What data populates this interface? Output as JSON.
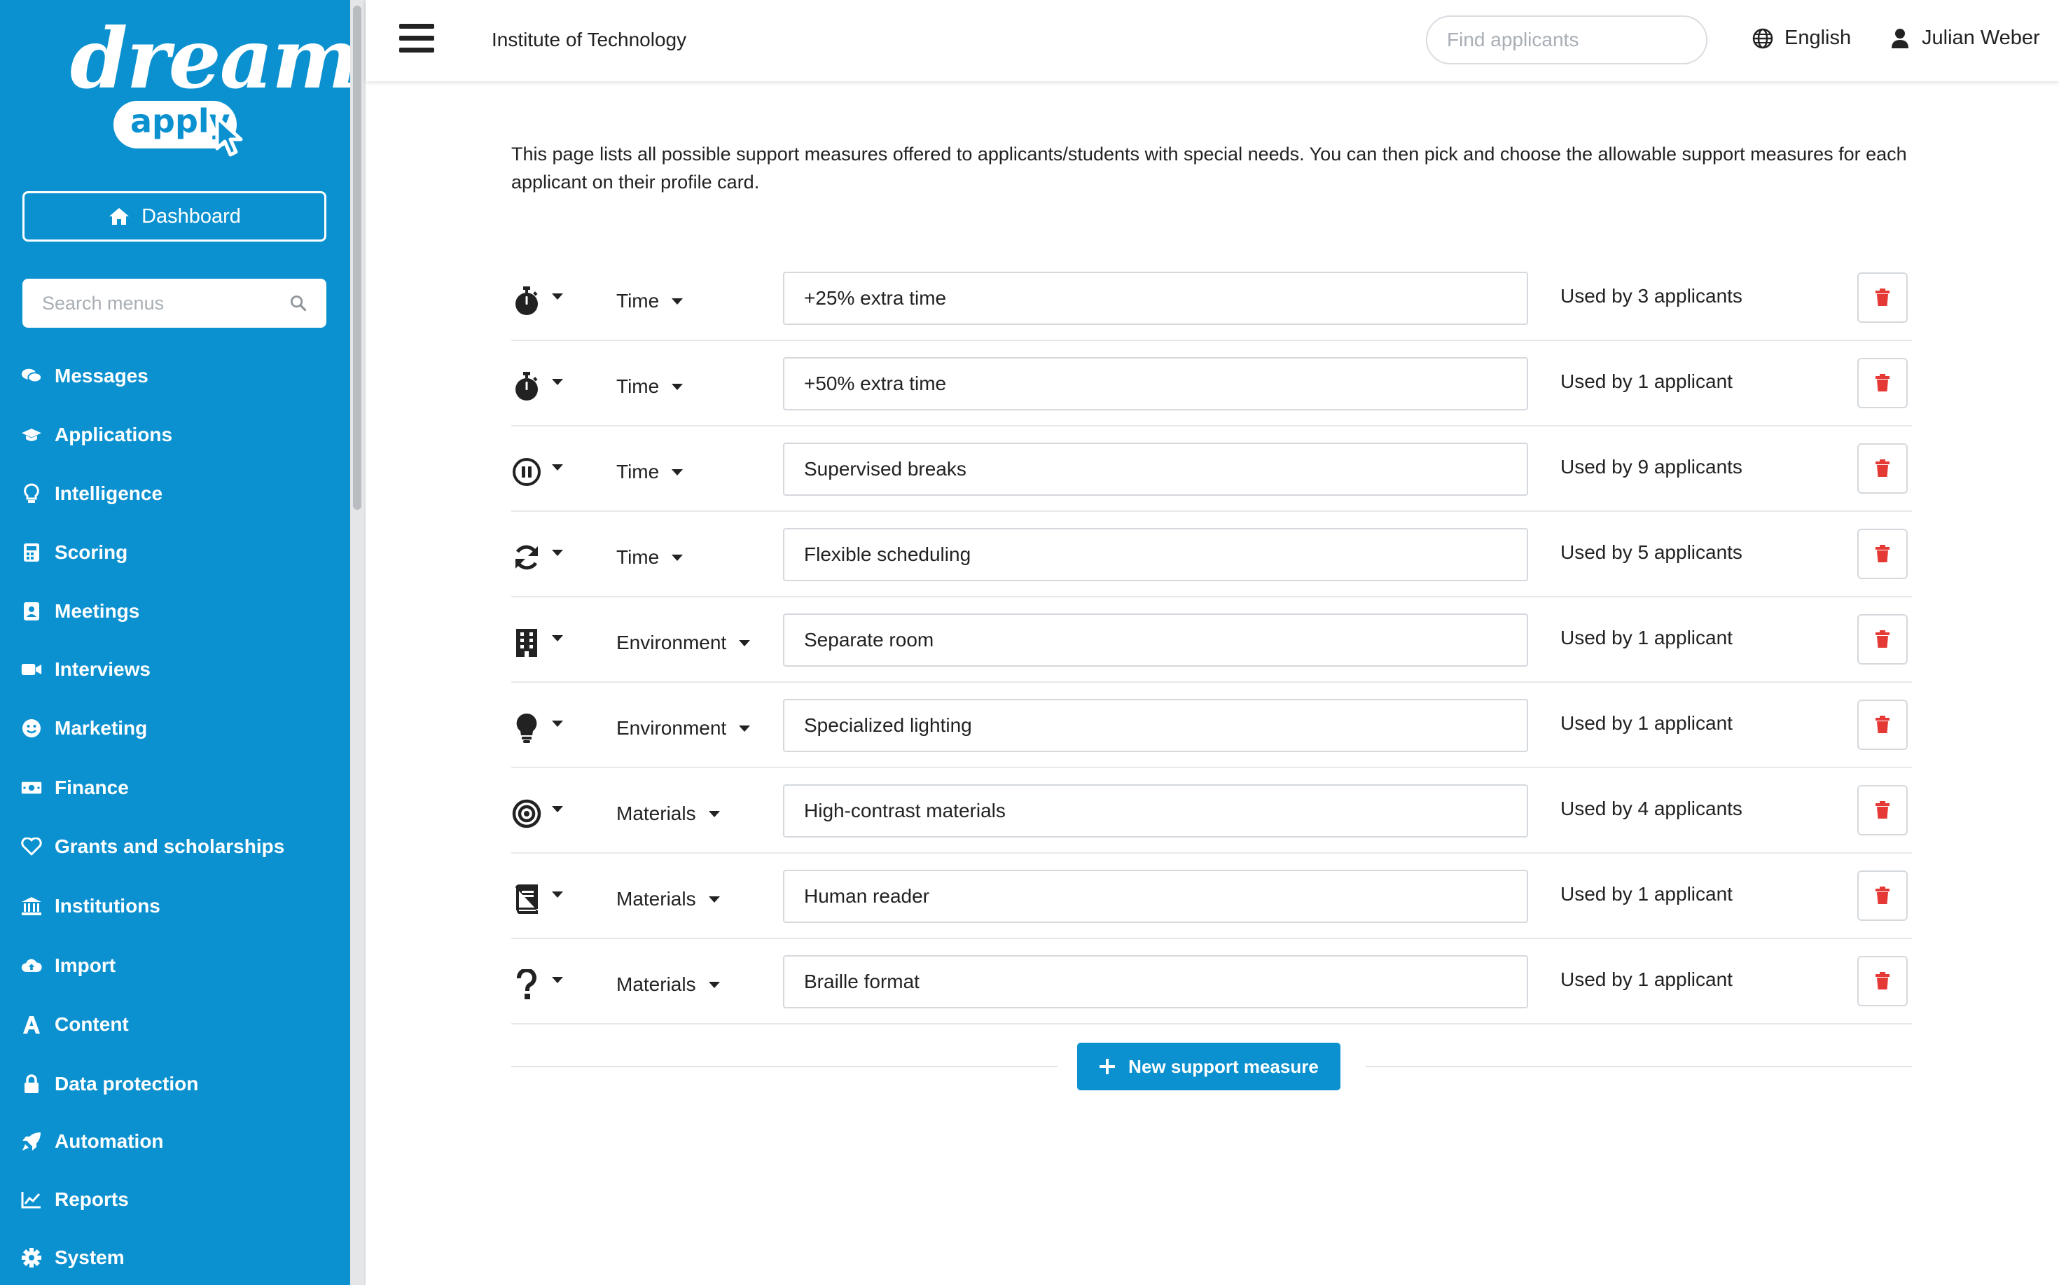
{
  "brand": {
    "word1": "dream",
    "word2": "apply"
  },
  "sidebar": {
    "dashboard_label": "Dashboard",
    "search_placeholder": "Search menus",
    "items": [
      {
        "label": "Messages",
        "icon": "messages-icon"
      },
      {
        "label": "Applications",
        "icon": "graduation-cap-icon"
      },
      {
        "label": "Intelligence",
        "icon": "lightbulb-icon"
      },
      {
        "label": "Scoring",
        "icon": "calculator-icon"
      },
      {
        "label": "Meetings",
        "icon": "contact-card-icon"
      },
      {
        "label": "Interviews",
        "icon": "video-camera-icon"
      },
      {
        "label": "Marketing",
        "icon": "smiley-icon"
      },
      {
        "label": "Finance",
        "icon": "money-icon"
      },
      {
        "label": "Grants and scholarships",
        "icon": "heart-icon"
      },
      {
        "label": "Institutions",
        "icon": "institution-icon"
      },
      {
        "label": "Import",
        "icon": "cloud-upload-icon"
      },
      {
        "label": "Content",
        "icon": "font-icon"
      },
      {
        "label": "Data protection",
        "icon": "lock-icon"
      },
      {
        "label": "Automation",
        "icon": "rocket-icon"
      },
      {
        "label": "Reports",
        "icon": "line-chart-icon"
      },
      {
        "label": "System",
        "icon": "gear-icon"
      }
    ]
  },
  "header": {
    "institution": "Institute of Technology",
    "search_placeholder": "Find applicants",
    "language": "English",
    "user": "Julian Weber"
  },
  "main": {
    "intro": "This page lists all possible support measures offered to applicants/students with special needs. You can then pick and choose the allowable support measures for each applicant on their profile card.",
    "measures": [
      {
        "icon": "stopwatch-icon",
        "category": "Time",
        "name": "+25% extra time",
        "usage": "Used by 3 applicants"
      },
      {
        "icon": "stopwatch-icon",
        "category": "Time",
        "name": "+50% extra time",
        "usage": "Used by 1 applicant"
      },
      {
        "icon": "pause-circle-icon",
        "category": "Time",
        "name": "Supervised breaks",
        "usage": "Used by 9 applicants"
      },
      {
        "icon": "refresh-icon",
        "category": "Time",
        "name": "Flexible scheduling",
        "usage": "Used by 5 applicants"
      },
      {
        "icon": "building-icon",
        "category": "Environment",
        "name": "Separate room",
        "usage": "Used by 1 applicant"
      },
      {
        "icon": "lightbulb-icon",
        "category": "Environment",
        "name": "Specialized lighting",
        "usage": "Used by 1 applicant"
      },
      {
        "icon": "bullseye-icon",
        "category": "Materials",
        "name": "High-contrast materials",
        "usage": "Used by 4 applicants"
      },
      {
        "icon": "book-icon",
        "category": "Materials",
        "name": "Human reader",
        "usage": "Used by 1 applicant"
      },
      {
        "icon": "question-icon",
        "category": "Materials",
        "name": "Braille format",
        "usage": "Used by 1 applicant"
      }
    ],
    "new_button": "New support measure"
  },
  "colors": {
    "brand": "#0b91d0",
    "danger": "#e53935",
    "text": "#222222"
  }
}
